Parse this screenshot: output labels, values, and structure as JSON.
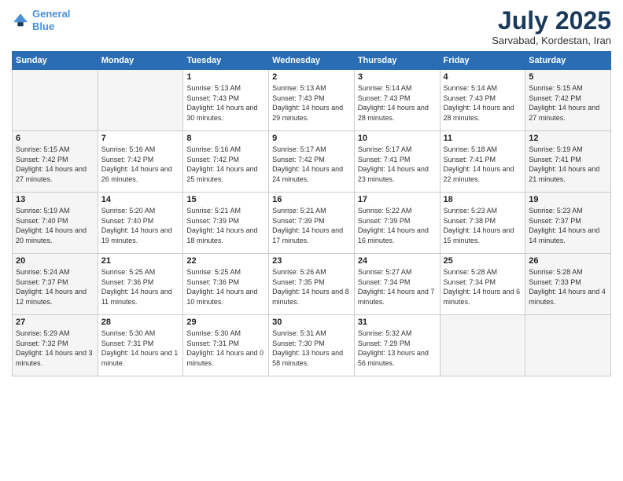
{
  "logo": {
    "line1": "General",
    "line2": "Blue"
  },
  "title": "July 2025",
  "location": "Sarvabad, Kordestan, Iran",
  "headers": [
    "Sunday",
    "Monday",
    "Tuesday",
    "Wednesday",
    "Thursday",
    "Friday",
    "Saturday"
  ],
  "weeks": [
    [
      {
        "day": "",
        "detail": ""
      },
      {
        "day": "",
        "detail": ""
      },
      {
        "day": "1",
        "detail": "Sunrise: 5:13 AM\nSunset: 7:43 PM\nDaylight: 14 hours\nand 30 minutes."
      },
      {
        "day": "2",
        "detail": "Sunrise: 5:13 AM\nSunset: 7:43 PM\nDaylight: 14 hours\nand 29 minutes."
      },
      {
        "day": "3",
        "detail": "Sunrise: 5:14 AM\nSunset: 7:43 PM\nDaylight: 14 hours\nand 28 minutes."
      },
      {
        "day": "4",
        "detail": "Sunrise: 5:14 AM\nSunset: 7:43 PM\nDaylight: 14 hours\nand 28 minutes."
      },
      {
        "day": "5",
        "detail": "Sunrise: 5:15 AM\nSunset: 7:42 PM\nDaylight: 14 hours\nand 27 minutes."
      }
    ],
    [
      {
        "day": "6",
        "detail": "Sunrise: 5:15 AM\nSunset: 7:42 PM\nDaylight: 14 hours\nand 27 minutes."
      },
      {
        "day": "7",
        "detail": "Sunrise: 5:16 AM\nSunset: 7:42 PM\nDaylight: 14 hours\nand 26 minutes."
      },
      {
        "day": "8",
        "detail": "Sunrise: 5:16 AM\nSunset: 7:42 PM\nDaylight: 14 hours\nand 25 minutes."
      },
      {
        "day": "9",
        "detail": "Sunrise: 5:17 AM\nSunset: 7:42 PM\nDaylight: 14 hours\nand 24 minutes."
      },
      {
        "day": "10",
        "detail": "Sunrise: 5:17 AM\nSunset: 7:41 PM\nDaylight: 14 hours\nand 23 minutes."
      },
      {
        "day": "11",
        "detail": "Sunrise: 5:18 AM\nSunset: 7:41 PM\nDaylight: 14 hours\nand 22 minutes."
      },
      {
        "day": "12",
        "detail": "Sunrise: 5:19 AM\nSunset: 7:41 PM\nDaylight: 14 hours\nand 21 minutes."
      }
    ],
    [
      {
        "day": "13",
        "detail": "Sunrise: 5:19 AM\nSunset: 7:40 PM\nDaylight: 14 hours\nand 20 minutes."
      },
      {
        "day": "14",
        "detail": "Sunrise: 5:20 AM\nSunset: 7:40 PM\nDaylight: 14 hours\nand 19 minutes."
      },
      {
        "day": "15",
        "detail": "Sunrise: 5:21 AM\nSunset: 7:39 PM\nDaylight: 14 hours\nand 18 minutes."
      },
      {
        "day": "16",
        "detail": "Sunrise: 5:21 AM\nSunset: 7:39 PM\nDaylight: 14 hours\nand 17 minutes."
      },
      {
        "day": "17",
        "detail": "Sunrise: 5:22 AM\nSunset: 7:39 PM\nDaylight: 14 hours\nand 16 minutes."
      },
      {
        "day": "18",
        "detail": "Sunrise: 5:23 AM\nSunset: 7:38 PM\nDaylight: 14 hours\nand 15 minutes."
      },
      {
        "day": "19",
        "detail": "Sunrise: 5:23 AM\nSunset: 7:37 PM\nDaylight: 14 hours\nand 14 minutes."
      }
    ],
    [
      {
        "day": "20",
        "detail": "Sunrise: 5:24 AM\nSunset: 7:37 PM\nDaylight: 14 hours\nand 12 minutes."
      },
      {
        "day": "21",
        "detail": "Sunrise: 5:25 AM\nSunset: 7:36 PM\nDaylight: 14 hours\nand 11 minutes."
      },
      {
        "day": "22",
        "detail": "Sunrise: 5:25 AM\nSunset: 7:36 PM\nDaylight: 14 hours\nand 10 minutes."
      },
      {
        "day": "23",
        "detail": "Sunrise: 5:26 AM\nSunset: 7:35 PM\nDaylight: 14 hours\nand 8 minutes."
      },
      {
        "day": "24",
        "detail": "Sunrise: 5:27 AM\nSunset: 7:34 PM\nDaylight: 14 hours\nand 7 minutes."
      },
      {
        "day": "25",
        "detail": "Sunrise: 5:28 AM\nSunset: 7:34 PM\nDaylight: 14 hours\nand 6 minutes."
      },
      {
        "day": "26",
        "detail": "Sunrise: 5:28 AM\nSunset: 7:33 PM\nDaylight: 14 hours\nand 4 minutes."
      }
    ],
    [
      {
        "day": "27",
        "detail": "Sunrise: 5:29 AM\nSunset: 7:32 PM\nDaylight: 14 hours\nand 3 minutes."
      },
      {
        "day": "28",
        "detail": "Sunrise: 5:30 AM\nSunset: 7:31 PM\nDaylight: 14 hours\nand 1 minute."
      },
      {
        "day": "29",
        "detail": "Sunrise: 5:30 AM\nSunset: 7:31 PM\nDaylight: 14 hours\nand 0 minutes."
      },
      {
        "day": "30",
        "detail": "Sunrise: 5:31 AM\nSunset: 7:30 PM\nDaylight: 13 hours\nand 58 minutes."
      },
      {
        "day": "31",
        "detail": "Sunrise: 5:32 AM\nSunset: 7:29 PM\nDaylight: 13 hours\nand 56 minutes."
      },
      {
        "day": "",
        "detail": ""
      },
      {
        "day": "",
        "detail": ""
      }
    ]
  ]
}
